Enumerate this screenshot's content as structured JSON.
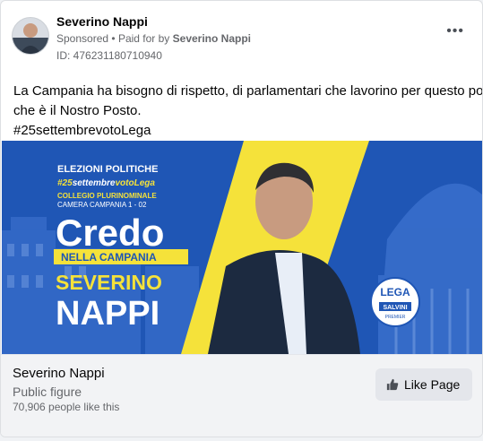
{
  "post": {
    "page_name": "Severino Nappi",
    "sponsored": "Sponsored",
    "separator": "•",
    "paid_prefix": "Paid for by",
    "paid_by": "Severino Nappi",
    "ad_id": "ID: 476231180710940",
    "more_icon": "more-horizontal-icon",
    "text_lines": [
      "La Campania ha bisogno di rispetto, di parlamentari che lavorino per questo posto,",
      "che è il Nostro Posto.",
      "#25settembrevotoLega"
    ]
  },
  "banner": {
    "elezioni": "ELEZIONI POLITICHE",
    "hashtag_a": "#25",
    "hashtag_b": "settembre",
    "hashtag_c": "votoLega",
    "collegio": "COLLEGIO PLURINOMINALE",
    "camera": "CAMERA CAMPANIA 1 - 02",
    "credo": "Credo",
    "nella": "NELLA CAMPANIA",
    "name1": "SEVERINO",
    "name2": "NAPPI",
    "logo_lega": "LEGA",
    "logo_salvini": "SALVINI",
    "logo_premier": "PREMIER",
    "colors": {
      "blue": "#1f56b5",
      "yellow": "#f5e23a"
    }
  },
  "footer": {
    "page_name": "Severino Nappi",
    "category": "Public figure",
    "likes": "70,906 people like this",
    "like_button": "Like Page",
    "like_icon": "thumbs-up-icon"
  }
}
